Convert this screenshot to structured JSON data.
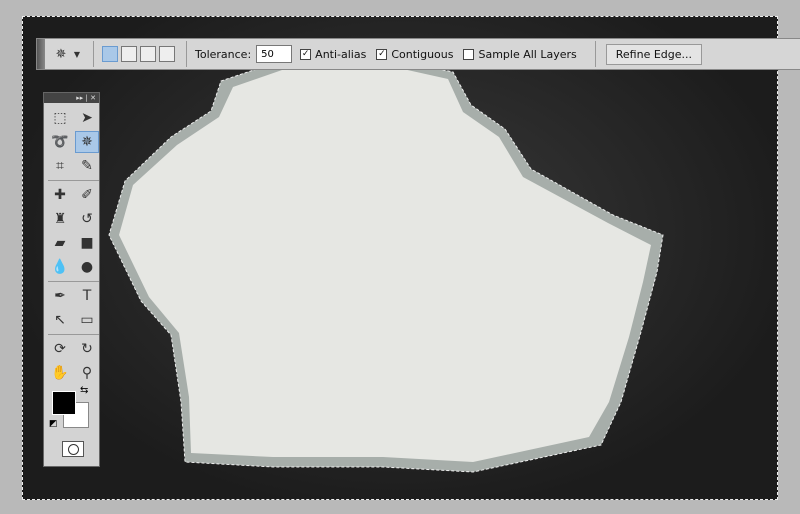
{
  "options_bar": {
    "tool_icon": "magic-wand-icon",
    "selection_modes": [
      "new-selection",
      "add-to-selection",
      "subtract-from-selection",
      "intersect-selection"
    ],
    "tolerance_label": "Tolerance:",
    "tolerance_value": "50",
    "anti_alias": {
      "label": "Anti-alias",
      "checked": true
    },
    "contiguous": {
      "label": "Contiguous",
      "checked": true
    },
    "sample_all_layers": {
      "label": "Sample All Layers",
      "checked": false
    },
    "refine_edge_label": "Refine Edge..."
  },
  "toolbox": {
    "header_glyphs": "▸▸ | ✕",
    "tools": [
      {
        "name": "rectangular-marquee",
        "glyph": "⬚"
      },
      {
        "name": "move",
        "glyph": "➤"
      },
      {
        "name": "lasso",
        "glyph": "➰"
      },
      {
        "name": "magic-wand",
        "glyph": "✵",
        "active": true
      },
      {
        "name": "crop",
        "glyph": "⌗"
      },
      {
        "name": "eyedropper",
        "glyph": "✎"
      },
      {
        "name": "healing-brush",
        "glyph": "✚"
      },
      {
        "name": "brush",
        "glyph": "✐"
      },
      {
        "name": "clone-stamp",
        "glyph": "♜"
      },
      {
        "name": "history-brush",
        "glyph": "↺"
      },
      {
        "name": "eraser",
        "glyph": "▰"
      },
      {
        "name": "gradient",
        "glyph": "■"
      },
      {
        "name": "blur",
        "glyph": "💧"
      },
      {
        "name": "dodge",
        "glyph": "●"
      },
      {
        "name": "pen",
        "glyph": "✒"
      },
      {
        "name": "type",
        "glyph": "T"
      },
      {
        "name": "path-selection",
        "glyph": "↖"
      },
      {
        "name": "rectangle",
        "glyph": "▭"
      },
      {
        "name": "3d-rotate",
        "glyph": "⟳"
      },
      {
        "name": "3d-orbit",
        "glyph": "↻"
      },
      {
        "name": "hand",
        "glyph": "✋"
      },
      {
        "name": "zoom",
        "glyph": "⚲"
      }
    ],
    "foreground_color": "#000000",
    "background_color": "#ffffff"
  }
}
